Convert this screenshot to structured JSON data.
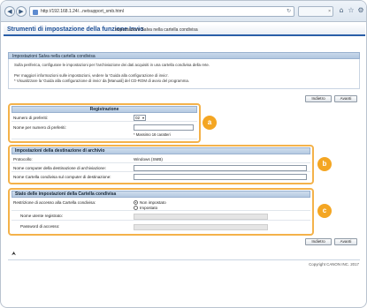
{
  "browser": {
    "url": "http://192.168.1.24/...netsupport_smb.html",
    "tab_title": "",
    "back_glyph": "◀",
    "forward_glyph": "▶",
    "go_glyph": "↻",
    "tab_close_glyph": "×",
    "toolbar_icons": [
      "home-icon",
      "star-icon",
      "settings-icon"
    ],
    "toolbar_glyphs": [
      "⌂",
      "☆",
      "⚙"
    ]
  },
  "header": {
    "title": "Strumenti di impostazione della funzione Invio",
    "subtitle": "Impostazioni Salva nella cartella condivisa"
  },
  "intro": {
    "section_title": "Impostazioni Salva nella cartella condivisa",
    "line1": "Sulla periferica, configurare le impostazioni per l'archiviazione dei dati acquisiti in una cartella condivisa della rete.",
    "line2": "Per maggiori informazioni sulle impostazioni, vedere la 'Guida alla configurazione di invio'.",
    "line3": "* Visualizzare la 'Guida alla configurazione di invio' da [Manuali] del CD-ROM di avvio del programma."
  },
  "buttons": {
    "back": "Indietro",
    "next": "Avanti"
  },
  "registration": {
    "title": "Registrazione",
    "num_label": "Numero di preferiti:",
    "num_value": "02",
    "name_label": "Nome per numero di preferiti:",
    "name_value": "",
    "name_hint": "* Massimo 16 caratteri"
  },
  "archive": {
    "title": "Impostazioni della destinazione di archivio",
    "protocol_label": "Protocollo:",
    "protocol_value": "Windows (SMB)",
    "computer_label": "Nome computer della destinazione di archiviazione:",
    "computer_value": "",
    "folder_label": "Nome Cartella condivisa sul computer di destinazione:",
    "folder_value": ""
  },
  "status": {
    "title": "Stato delle impostazioni della Cartella condivisa",
    "restriction_label": "Restrizione di accesso alla Cartella condivisa:",
    "option_off": "Non impostato",
    "option_on": "Impostato",
    "user_label": "Nome utente registrato:",
    "password_label": "Password di accesso:"
  },
  "markers": {
    "a": "a",
    "b": "b",
    "c": "c"
  },
  "footer": {
    "copyright": "Copyright CANON INC. 2017",
    "top_glyph": "⮝"
  },
  "colors": {
    "highlight": "#f4b24a",
    "marker": "#f4a623",
    "header_blue": "#1c4f96",
    "section_header": "#b6cae2"
  }
}
